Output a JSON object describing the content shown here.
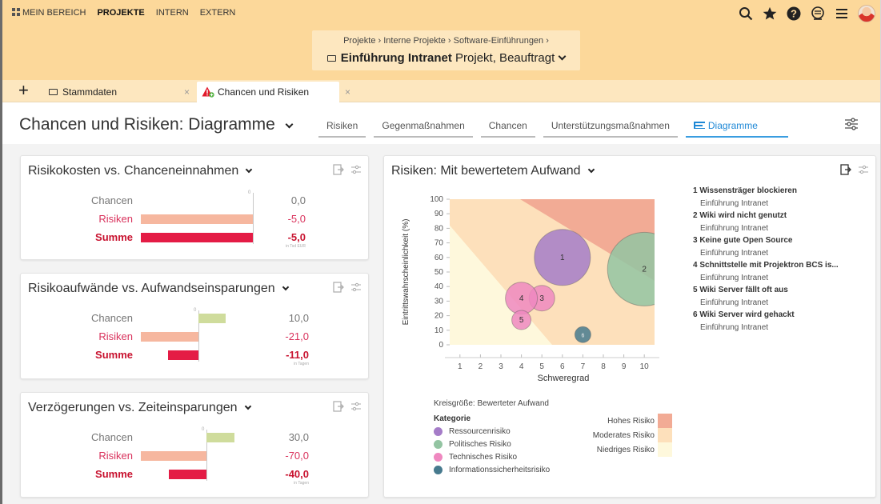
{
  "topnav": {
    "items": [
      {
        "label": "MEIN BEREICH",
        "active": false
      },
      {
        "label": "PROJEKTE",
        "active": true
      },
      {
        "label": "INTERN",
        "active": false
      },
      {
        "label": "EXTERN",
        "active": false
      }
    ],
    "icons": [
      "search-icon",
      "star-icon",
      "help-icon",
      "notification-icon",
      "menu-icon",
      "avatar"
    ]
  },
  "context": {
    "breadcrumb": "Projekte  ›  Interne Projekte  ›  Software-Einführungen  ›",
    "title_bold": "Einführung Intranet",
    "title_rest": " Projekt, Beauftragt"
  },
  "tabs": {
    "add_label": "+",
    "items": [
      {
        "label": "Stammdaten",
        "icon": "folder-icon"
      },
      {
        "label": "Chancen und Risiken",
        "icon": "warning-icon"
      }
    ],
    "close_label": "×"
  },
  "page": {
    "title": "Chancen und Risiken: Diagramme",
    "subtabs": [
      "Risiken",
      "Gegenmaßnahmen",
      "Chancen",
      "Unterstützungsmaßnahmen",
      "Diagramme"
    ],
    "active_subtab": "Diagramme"
  },
  "colors": {
    "header": "#fcd89a",
    "chancen_bar": "#cfdc9c",
    "risiken_bar": "#f6b79f",
    "summe_bar": "#e41c45",
    "accent": "#1e88d6"
  },
  "cards": [
    {
      "title": "Risikokosten vs. Chanceneinnahmen",
      "unit_note": "in Tsd EUR",
      "zero_tick": "0",
      "rows": [
        {
          "label": "Chancen",
          "value_text": "0,0",
          "value": 0
        },
        {
          "label": "Risiken",
          "value_text": "-5,0",
          "value": -5
        },
        {
          "label": "Summe",
          "value_text": "-5,0",
          "value": -5
        }
      ]
    },
    {
      "title": "Risikoaufwände vs. Aufwandseinsparungen",
      "unit_note": "in Tagen",
      "zero_tick": "0",
      "rows": [
        {
          "label": "Chancen",
          "value_text": "10,0",
          "value": 10
        },
        {
          "label": "Risiken",
          "value_text": "-21,0",
          "value": -21
        },
        {
          "label": "Summe",
          "value_text": "-11,0",
          "value": -11
        }
      ]
    },
    {
      "title": "Verzögerungen vs. Zeiteinsparungen",
      "unit_note": "in Tagen",
      "zero_tick": "0",
      "rows": [
        {
          "label": "Chancen",
          "value_text": "30,0",
          "value": 30
        },
        {
          "label": "Risiken",
          "value_text": "-70,0",
          "value": -70
        },
        {
          "label": "Summe",
          "value_text": "-40,0",
          "value": -40
        }
      ]
    }
  ],
  "bubble": {
    "title": "Risiken: Mit bewertetem Aufwand",
    "ylabel": "Eintrittswahrscheinlichkeit (%)",
    "xlabel": "Schweregrad",
    "size_note": "Kreisgröße: Bewerteter Aufwand",
    "category_title": "Kategorie",
    "categories": [
      {
        "name": "Ressourcenrisiko",
        "color": "#a57cc8"
      },
      {
        "name": "Politisches Risiko",
        "color": "#93c4a2"
      },
      {
        "name": "Technisches Risiko",
        "color": "#ef88c0"
      },
      {
        "name": "Informationssicherheitsrisiko",
        "color": "#477a8e"
      }
    ],
    "risk_levels": [
      {
        "name": "Hohes Risiko",
        "color": "#f2ab95"
      },
      {
        "name": "Moderates Risiko",
        "color": "#fde0bb"
      },
      {
        "name": "Niedriges Risiko",
        "color": "#fef8dc"
      }
    ],
    "risks": [
      {
        "num": "1",
        "title": "Wissensträger blockieren",
        "project": "Einführung Intranet"
      },
      {
        "num": "2",
        "title": "Wiki wird nicht genutzt",
        "project": "Einführung Intranet"
      },
      {
        "num": "3",
        "title": "Keine gute Open Source",
        "project": "Einführung Intranet"
      },
      {
        "num": "4",
        "title": "Schnittstelle mit Projektron BCS is...",
        "project": "Einführung Intranet"
      },
      {
        "num": "5",
        "title": "Wiki Server fällt oft aus",
        "project": "Einführung Intranet"
      },
      {
        "num": "6",
        "title": "Wiki Server wird gehackt",
        "project": "Einführung Intranet"
      }
    ]
  },
  "chart_data": {
    "type": "scatter",
    "title": "Risiken: Mit bewertetem Aufwand",
    "xlabel": "Schweregrad",
    "ylabel": "Eintrittswahrscheinlichkeit (%)",
    "xlim": [
      0.5,
      10.5
    ],
    "ylim": [
      0,
      100
    ],
    "xticks": [
      1,
      2,
      3,
      4,
      5,
      6,
      7,
      8,
      9,
      10
    ],
    "yticks": [
      0,
      10,
      20,
      30,
      40,
      50,
      60,
      70,
      80,
      90,
      100
    ],
    "points": [
      {
        "label": "1",
        "x": 6.0,
        "y": 60,
        "r": 35,
        "category": "Ressourcenrisiko"
      },
      {
        "label": "2",
        "x": 10.0,
        "y": 52,
        "r": 46,
        "category": "Politisches Risiko"
      },
      {
        "label": "3",
        "x": 5.0,
        "y": 32,
        "r": 16,
        "category": "Technisches Risiko"
      },
      {
        "label": "4",
        "x": 4.0,
        "y": 32,
        "r": 20,
        "category": "Technisches Risiko"
      },
      {
        "label": "5",
        "x": 4.0,
        "y": 17,
        "r": 12,
        "category": "Technisches Risiko"
      },
      {
        "label": "6",
        "x": 7.0,
        "y": 7,
        "r": 10,
        "category": "Informationssicherheitsrisiko"
      }
    ]
  }
}
